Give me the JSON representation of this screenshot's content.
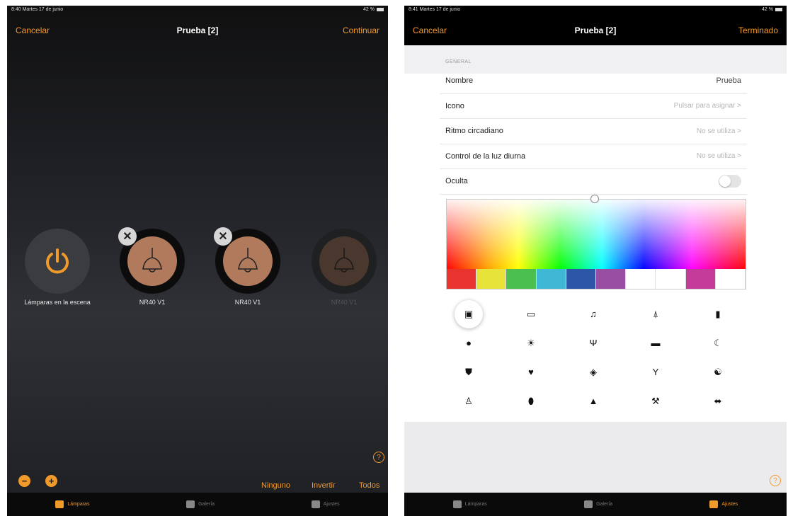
{
  "left": {
    "status": {
      "time": "8:40",
      "date": "Martes 17 de junio",
      "battery": "42 %"
    },
    "nav": {
      "cancel": "Cancelar",
      "title": "Prueba [2]",
      "continue": "Continuar"
    },
    "power_label": "Lámparas en la escena",
    "lamps": [
      {
        "label": "NR40 V1"
      },
      {
        "label": "NR40 V1"
      },
      {
        "label": "NR40 V1"
      }
    ],
    "remove_symbol": "✕",
    "help": "?",
    "minus": "−",
    "plus": "+",
    "actions": {
      "none": "Ninguno",
      "invert": "Invertir",
      "all": "Todos"
    },
    "tabs": {
      "lamps": "Lámparas",
      "gallery": "Galería",
      "settings": "Ajustes"
    }
  },
  "right": {
    "status": {
      "time": "8:41",
      "date": "Martes 17 de junio",
      "battery": "42 %"
    },
    "nav": {
      "cancel": "Cancelar",
      "title": "Prueba [2]",
      "done": "Terminado"
    },
    "section": "GENERAL",
    "rows": {
      "name_label": "Nombre",
      "name_value": "Prueba",
      "icon_label": "Icono",
      "icon_value": "Pulsar para asignar >",
      "circadian_label": "Ritmo circadiano",
      "circadian_value": "No se utiliza >",
      "daylight_label": "Control de la luz diurna",
      "daylight_value": "No se utiliza >",
      "hidden_label": "Oculta"
    },
    "swatch_colors": [
      "#e8332e",
      "#e8e33a",
      "#4bbf4f",
      "#3fb8d6",
      "#2d55a8",
      "#9a4ea3",
      "#ffffff",
      "#ffffff",
      "#c53b9a",
      "#ffffff"
    ],
    "icons": [
      "archive-icon",
      "monitor-icon",
      "music-icon",
      "bell-icon",
      "book-icon",
      "circle-icon",
      "sun-icon",
      "cutlery-icon",
      "bed-icon",
      "moon-icon",
      "shield-icon",
      "heart-icon",
      "tag-icon",
      "wine-glass-icon",
      "yin-yang-icon",
      "person-icon",
      "balloon-icon",
      "tree-icon",
      "hammer-icon",
      "dumbbell-icon"
    ],
    "help": "?",
    "tabs": {
      "lamps": "Lámparas",
      "gallery": "Galería",
      "settings": "Ajustes"
    }
  },
  "colors": {
    "accent": "#f19a2c",
    "lamp": "#b27a5c"
  }
}
